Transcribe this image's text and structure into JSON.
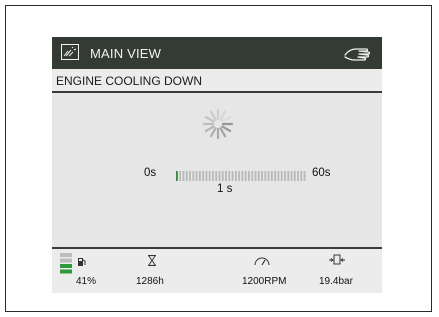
{
  "header": {
    "title": "MAIN VIEW",
    "title_icon": "screen-icon",
    "right_icon": "hand-icon"
  },
  "status": {
    "message": "ENGINE COOLING DOWN"
  },
  "cooldown": {
    "start_label": "0s",
    "end_label": "60s",
    "elapsed_label": "1 s",
    "progress_fraction": 0.0167,
    "spinner_icon": "loading-spinner-icon"
  },
  "footer": {
    "fuel": {
      "value": "41%",
      "icon": "fuel-pump-icon",
      "level_fraction": 0.41
    },
    "hours": {
      "value": "1286h",
      "icon": "hourglass-icon"
    },
    "rpm": {
      "value": "1200RPM",
      "icon": "gauge-icon"
    },
    "pressure": {
      "value": "19.4bar",
      "icon": "pressure-icon"
    }
  },
  "colors": {
    "titlebar": "#343a34",
    "progress_fill": "#2e8b3a",
    "fuel_level": "#2e9a3a"
  }
}
